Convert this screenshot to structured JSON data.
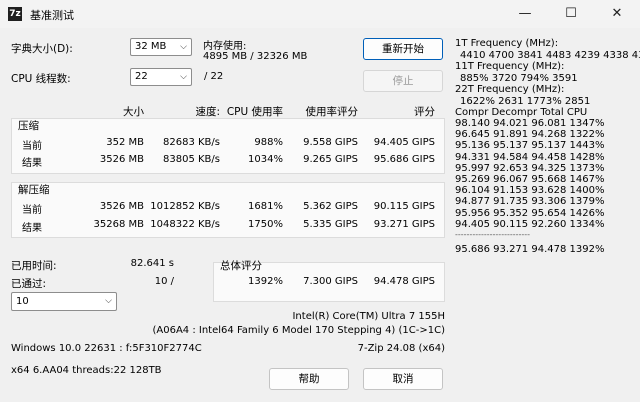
{
  "window": {
    "title": "基准测试",
    "minimize": "—",
    "maximize": "☐",
    "close": "✕",
    "icon": "7z"
  },
  "dict": {
    "label": "字典大小(D):",
    "value": "32 MB"
  },
  "threads": {
    "label": "CPU 线程数:",
    "value": "22",
    "total": "/ 22"
  },
  "memory": {
    "label": "内存使用:",
    "value": "4895 MB / 32326 MB"
  },
  "buttons": {
    "restart": "重新开始",
    "stop": "停止",
    "help": "帮助",
    "cancel": "取消"
  },
  "headers": {
    "size": "大小",
    "speed": "速度:",
    "cpu": "CPU 使用率",
    "rating_per": "使用率评分",
    "rating": "评分"
  },
  "compress": {
    "title": "压缩",
    "current": {
      "label": "当前",
      "size": "352 MB",
      "speed": "82683 KB/s",
      "cpu": "988%",
      "per": "9.558 GIPS",
      "rating": "94.405 GIPS"
    },
    "result": {
      "label": "结果",
      "size": "3526 MB",
      "speed": "83805 KB/s",
      "cpu": "1034%",
      "per": "9.265 GIPS",
      "rating": "95.686 GIPS"
    }
  },
  "decompress": {
    "title": "解压缩",
    "current": {
      "label": "当前",
      "size": "3526 MB",
      "speed": "1012852 KB/s",
      "cpu": "1681%",
      "per": "5.362 GIPS",
      "rating": "90.115 GIPS"
    },
    "result": {
      "label": "结果",
      "size": "35268 MB",
      "speed": "1048322 KB/s",
      "cpu": "1750%",
      "per": "5.335 GIPS",
      "rating": "93.271 GIPS"
    }
  },
  "elapsed": {
    "label": "已用时间:",
    "value": "82.641 s"
  },
  "passed": {
    "label": "已通过:",
    "value": "10 /",
    "select": "10"
  },
  "total": {
    "label": "总体评分",
    "cpu": "1392%",
    "per": "7.300 GIPS",
    "rating": "94.478 GIPS"
  },
  "cpu_info": {
    "line1": "Intel(R) Core(TM) Ultra 7 155H",
    "line2": "(A06A4 : Intel64 Family 6 Model 170 Stepping 4) (1C->1C)"
  },
  "sys": {
    "os": "Windows 10.0 22631 : f:5F310F2774C",
    "version": "7-Zip 24.08 (x64)",
    "arch": "x64 6.AA04 threads:22 128TB"
  },
  "freq": {
    "t1_label": "1T Frequency (MHz):",
    "t1_values": "4410 4700 3841 4483 4239 4338 4376",
    "t11_label": "11T Frequency (MHz):",
    "t11_values": "885% 3720 794% 3591",
    "t22_label": "22T Frequency (MHz):",
    "t22_values": "1622% 2631 1773% 2851"
  },
  "table": {
    "header": "Compr Decompr Total   CPU",
    "rows": [
      "98.140 94.021 96.081 1347%",
      "96.645 91.891 94.268 1322%",
      "95.136 95.137 95.137 1443%",
      "94.331 94.584 94.458 1428%",
      "95.997 92.653 94.325 1373%",
      "95.269 96.067 95.668 1467%",
      "96.104 91.153 93.628 1400%",
      "94.877 91.735 93.306 1379%",
      "95.956 95.352 95.654 1426%",
      "94.405 90.115 92.260 1334%"
    ],
    "separator": "--------------------------",
    "summary": "95.686 93.271 94.478 1392%"
  }
}
